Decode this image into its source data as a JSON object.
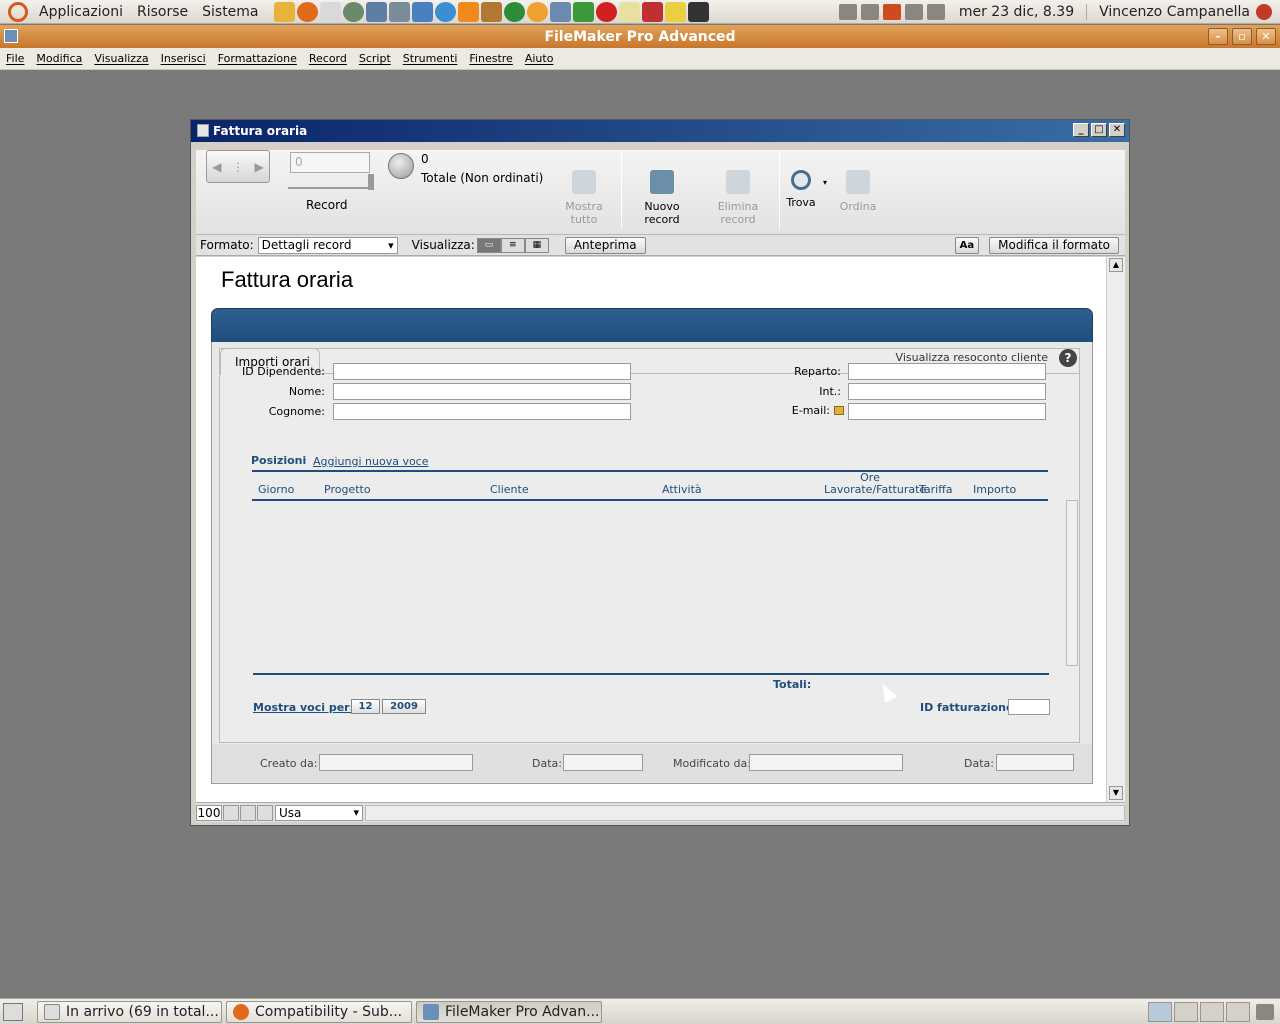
{
  "top_panel": {
    "menus": [
      "Applicazioni",
      "Risorse",
      "Sistema"
    ],
    "clock": "mer 23 dic, 8.39",
    "user": "Vincenzo Campanella"
  },
  "app": {
    "title": "FileMaker Pro Advanced",
    "menubar": [
      "File",
      "Modifica",
      "Visualizza",
      "Inserisci",
      "Formattazione",
      "Record",
      "Script",
      "Strumenti",
      "Finestre",
      "Aiuto"
    ]
  },
  "window": {
    "title": "Fattura oraria",
    "toolbar": {
      "record_field_value": "0",
      "record_label": "Record",
      "found_count": "0",
      "found_status": "Totale (Non ordinati)",
      "show_all": "Mostra tutto",
      "new_record": "Nuovo record",
      "delete_record": "Elimina record",
      "find": "Trova",
      "sort": "Ordina"
    },
    "layoutbar": {
      "format_label": "Formato:",
      "format_value": "Dettagli record",
      "view_label": "Visualizza:",
      "preview_button": "Anteprima",
      "aa_button": "Aa",
      "edit_layout_button": "Modifica il formato"
    },
    "page_title": "Fattura oraria",
    "tab_label": "Importi orari",
    "report_link": "Visualizza resoconto cliente",
    "help": "?",
    "fields_left": [
      {
        "label": "ID Dipendente:",
        "value": ""
      },
      {
        "label": "Nome:",
        "value": ""
      },
      {
        "label": "Cognome:",
        "value": ""
      }
    ],
    "fields_right": [
      {
        "label": "Reparto:",
        "value": ""
      },
      {
        "label": "Int.:",
        "value": ""
      },
      {
        "label": "E-mail:",
        "value": ""
      }
    ],
    "portal": {
      "section_title": "Posizioni",
      "add_link": "Aggiungi nuova voce",
      "columns": [
        "Giorno",
        "Progetto",
        "Cliente",
        "Attività",
        "Ore Lavorate/Fatturate",
        "Tariffa",
        "Importo"
      ],
      "rows": [],
      "totals_label": "Totali:"
    },
    "filter": {
      "show_label": "Mostra voci per:",
      "month": "12",
      "year": "2009",
      "invoice_id_label": "ID fatturazione:",
      "invoice_id_value": ""
    },
    "footer": {
      "created_by": "Creato da:",
      "created_date": "Data:",
      "modified_by": "Modificato da:",
      "modified_date": "Data:"
    },
    "bottombar": {
      "zoom": "100",
      "mode": "Usa"
    }
  },
  "taskbar": {
    "tasks": [
      "In arrivo (69 in total...",
      "Compatibility - Sub...",
      "FileMaker Pro Advan..."
    ]
  }
}
